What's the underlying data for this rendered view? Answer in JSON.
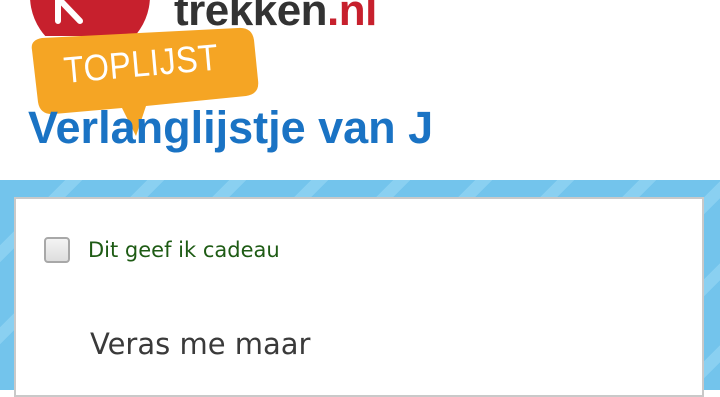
{
  "header": {
    "site_name_main": "trekken",
    "site_name_dot": ".",
    "site_name_tld": "nl",
    "badge_text": "TOPLIJST",
    "page_title": "Verlanglijstje van J"
  },
  "item": {
    "gift_checkbox_label": "Dit geef ik cadeau",
    "gift_checked": false,
    "title": "Veras me maar"
  },
  "colors": {
    "brand_red": "#c7202d",
    "title_blue": "#1a73c4",
    "badge_orange": "#f5a524",
    "band_blue": "#73c4ec",
    "label_green": "#1e5b14"
  }
}
